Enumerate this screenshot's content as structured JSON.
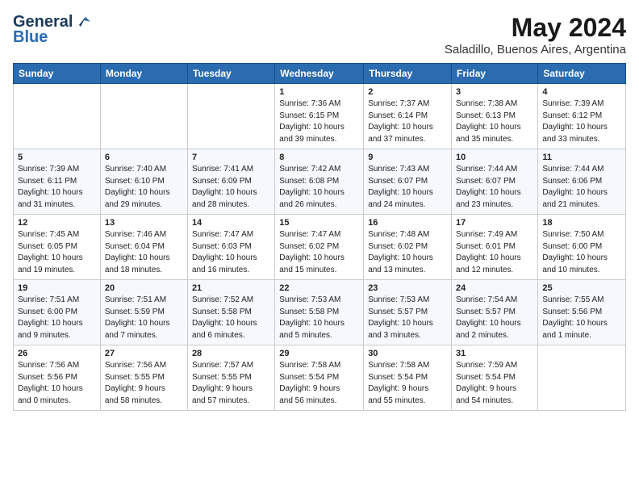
{
  "header": {
    "logo_line1": "General",
    "logo_line2": "Blue",
    "month_year": "May 2024",
    "location": "Saladillo, Buenos Aires, Argentina"
  },
  "weekdays": [
    "Sunday",
    "Monday",
    "Tuesday",
    "Wednesday",
    "Thursday",
    "Friday",
    "Saturday"
  ],
  "weeks": [
    [
      {
        "day": "",
        "info": ""
      },
      {
        "day": "",
        "info": ""
      },
      {
        "day": "",
        "info": ""
      },
      {
        "day": "1",
        "info": "Sunrise: 7:36 AM\nSunset: 6:15 PM\nDaylight: 10 hours\nand 39 minutes."
      },
      {
        "day": "2",
        "info": "Sunrise: 7:37 AM\nSunset: 6:14 PM\nDaylight: 10 hours\nand 37 minutes."
      },
      {
        "day": "3",
        "info": "Sunrise: 7:38 AM\nSunset: 6:13 PM\nDaylight: 10 hours\nand 35 minutes."
      },
      {
        "day": "4",
        "info": "Sunrise: 7:39 AM\nSunset: 6:12 PM\nDaylight: 10 hours\nand 33 minutes."
      }
    ],
    [
      {
        "day": "5",
        "info": "Sunrise: 7:39 AM\nSunset: 6:11 PM\nDaylight: 10 hours\nand 31 minutes."
      },
      {
        "day": "6",
        "info": "Sunrise: 7:40 AM\nSunset: 6:10 PM\nDaylight: 10 hours\nand 29 minutes."
      },
      {
        "day": "7",
        "info": "Sunrise: 7:41 AM\nSunset: 6:09 PM\nDaylight: 10 hours\nand 28 minutes."
      },
      {
        "day": "8",
        "info": "Sunrise: 7:42 AM\nSunset: 6:08 PM\nDaylight: 10 hours\nand 26 minutes."
      },
      {
        "day": "9",
        "info": "Sunrise: 7:43 AM\nSunset: 6:07 PM\nDaylight: 10 hours\nand 24 minutes."
      },
      {
        "day": "10",
        "info": "Sunrise: 7:44 AM\nSunset: 6:07 PM\nDaylight: 10 hours\nand 23 minutes."
      },
      {
        "day": "11",
        "info": "Sunrise: 7:44 AM\nSunset: 6:06 PM\nDaylight: 10 hours\nand 21 minutes."
      }
    ],
    [
      {
        "day": "12",
        "info": "Sunrise: 7:45 AM\nSunset: 6:05 PM\nDaylight: 10 hours\nand 19 minutes."
      },
      {
        "day": "13",
        "info": "Sunrise: 7:46 AM\nSunset: 6:04 PM\nDaylight: 10 hours\nand 18 minutes."
      },
      {
        "day": "14",
        "info": "Sunrise: 7:47 AM\nSunset: 6:03 PM\nDaylight: 10 hours\nand 16 minutes."
      },
      {
        "day": "15",
        "info": "Sunrise: 7:47 AM\nSunset: 6:02 PM\nDaylight: 10 hours\nand 15 minutes."
      },
      {
        "day": "16",
        "info": "Sunrise: 7:48 AM\nSunset: 6:02 PM\nDaylight: 10 hours\nand 13 minutes."
      },
      {
        "day": "17",
        "info": "Sunrise: 7:49 AM\nSunset: 6:01 PM\nDaylight: 10 hours\nand 12 minutes."
      },
      {
        "day": "18",
        "info": "Sunrise: 7:50 AM\nSunset: 6:00 PM\nDaylight: 10 hours\nand 10 minutes."
      }
    ],
    [
      {
        "day": "19",
        "info": "Sunrise: 7:51 AM\nSunset: 6:00 PM\nDaylight: 10 hours\nand 9 minutes."
      },
      {
        "day": "20",
        "info": "Sunrise: 7:51 AM\nSunset: 5:59 PM\nDaylight: 10 hours\nand 7 minutes."
      },
      {
        "day": "21",
        "info": "Sunrise: 7:52 AM\nSunset: 5:58 PM\nDaylight: 10 hours\nand 6 minutes."
      },
      {
        "day": "22",
        "info": "Sunrise: 7:53 AM\nSunset: 5:58 PM\nDaylight: 10 hours\nand 5 minutes."
      },
      {
        "day": "23",
        "info": "Sunrise: 7:53 AM\nSunset: 5:57 PM\nDaylight: 10 hours\nand 3 minutes."
      },
      {
        "day": "24",
        "info": "Sunrise: 7:54 AM\nSunset: 5:57 PM\nDaylight: 10 hours\nand 2 minutes."
      },
      {
        "day": "25",
        "info": "Sunrise: 7:55 AM\nSunset: 5:56 PM\nDaylight: 10 hours\nand 1 minute."
      }
    ],
    [
      {
        "day": "26",
        "info": "Sunrise: 7:56 AM\nSunset: 5:56 PM\nDaylight: 10 hours\nand 0 minutes."
      },
      {
        "day": "27",
        "info": "Sunrise: 7:56 AM\nSunset: 5:55 PM\nDaylight: 9 hours\nand 58 minutes."
      },
      {
        "day": "28",
        "info": "Sunrise: 7:57 AM\nSunset: 5:55 PM\nDaylight: 9 hours\nand 57 minutes."
      },
      {
        "day": "29",
        "info": "Sunrise: 7:58 AM\nSunset: 5:54 PM\nDaylight: 9 hours\nand 56 minutes."
      },
      {
        "day": "30",
        "info": "Sunrise: 7:58 AM\nSunset: 5:54 PM\nDaylight: 9 hours\nand 55 minutes."
      },
      {
        "day": "31",
        "info": "Sunrise: 7:59 AM\nSunset: 5:54 PM\nDaylight: 9 hours\nand 54 minutes."
      },
      {
        "day": "",
        "info": ""
      }
    ]
  ]
}
